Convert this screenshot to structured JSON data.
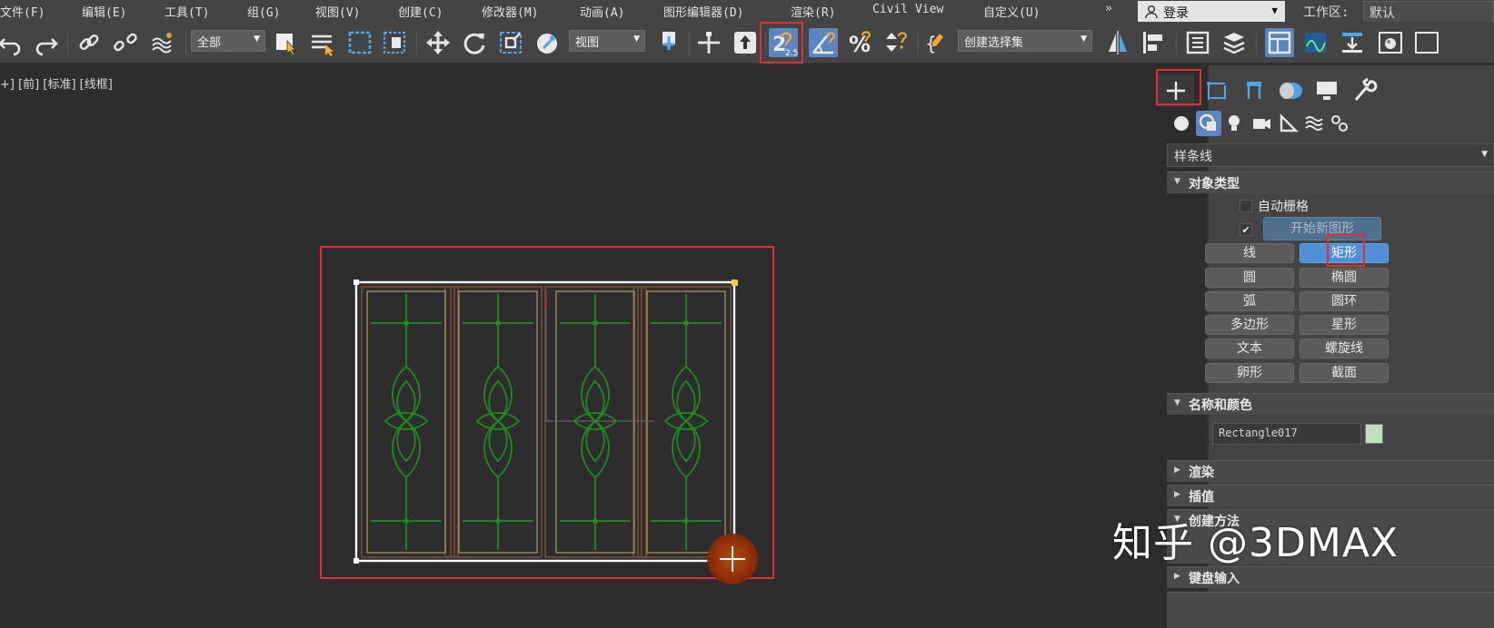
{
  "menubar": {
    "items": [
      "文件(F)",
      "编辑(E)",
      "工具(T)",
      "组(G)",
      "视图(V)",
      "创建(C)",
      "修改器(M)",
      "动画(A)",
      "图形编辑器(D)",
      "渲染(R)",
      "Civil View",
      "自定义(U)"
    ],
    "overflow": "»",
    "login": "登录",
    "workspace_label": "工作区:",
    "workspace_value": "默认"
  },
  "toolbar": {
    "selection_filter": "全部",
    "ref_coord": "视图",
    "named_selection": "创建选择集",
    "snap_label": "2.5"
  },
  "viewport": {
    "label": "+] [前] [标准] [线框]"
  },
  "panel": {
    "subtype": "样条线",
    "object_type": {
      "title": "对象类型",
      "auto_grid": "自动栅格",
      "start_new_checked": true,
      "start_new": "开始新图形",
      "buttons": [
        {
          "label": "线",
          "active": false
        },
        {
          "label": "矩形",
          "active": true
        },
        {
          "label": "圆",
          "active": false
        },
        {
          "label": "椭圆",
          "active": false
        },
        {
          "label": "弧",
          "active": false
        },
        {
          "label": "圆环",
          "active": false
        },
        {
          "label": "多边形",
          "active": false
        },
        {
          "label": "星形",
          "active": false
        },
        {
          "label": "文本",
          "active": false
        },
        {
          "label": "螺旋线",
          "active": false
        },
        {
          "label": "卵形",
          "active": false
        },
        {
          "label": "截面",
          "active": false
        }
      ]
    },
    "name_color": {
      "title": "名称和颜色",
      "name": "Rectangle017",
      "color": "#bde0bf"
    },
    "rollouts": [
      "渲染",
      "插值",
      "创建方法",
      "键盘输入"
    ]
  },
  "watermark": "知乎 @3DMAX",
  "colors": {
    "highlight_red": "#e03035",
    "active_blue": "#4f8fd6",
    "drawing_green": "#1e8a1e",
    "frame_brown": "#7a4a3a"
  }
}
